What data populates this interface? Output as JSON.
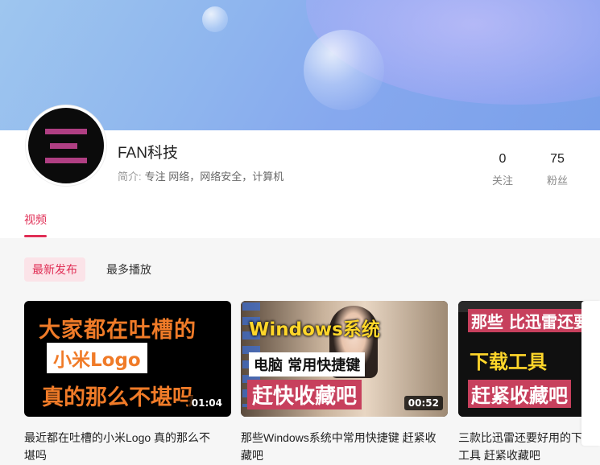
{
  "channel": {
    "name": "FAN科技",
    "bio_label": "简介:",
    "bio_text": "专注 网络，网络安全，计算机"
  },
  "stats": {
    "following_count": "0",
    "following_label": "关注",
    "fans_count": "75",
    "fans_label": "粉丝"
  },
  "tabs": [
    {
      "label": "视频",
      "active": true
    }
  ],
  "filters": {
    "latest": "最新发布",
    "most_played": "最多播放"
  },
  "videos": [
    {
      "title": "最近都在吐槽的小米Logo 真的那么不堪吗",
      "duration": "01:04",
      "thumb_lines": [
        "大家都在吐槽的",
        "小米Logo",
        "真的那么不堪吗"
      ]
    },
    {
      "title": "那些Windows系统中常用快捷键 赶紧收藏吧",
      "duration": "00:52",
      "thumb_lines": [
        "Windows系统",
        "电脑 常用快捷键",
        "赶快收藏吧"
      ]
    },
    {
      "title": "三款比迅雷还要好用的下载工具 赶紧收藏吧",
      "duration": "",
      "thumb_lines": [
        "那些 比迅雷还要",
        "下载工具",
        "赶紧收藏吧"
      ]
    }
  ],
  "colors": {
    "accent": "#e02e55",
    "avatar_bg": "#0b0b0b",
    "avatar_bars": "#b03f83"
  }
}
